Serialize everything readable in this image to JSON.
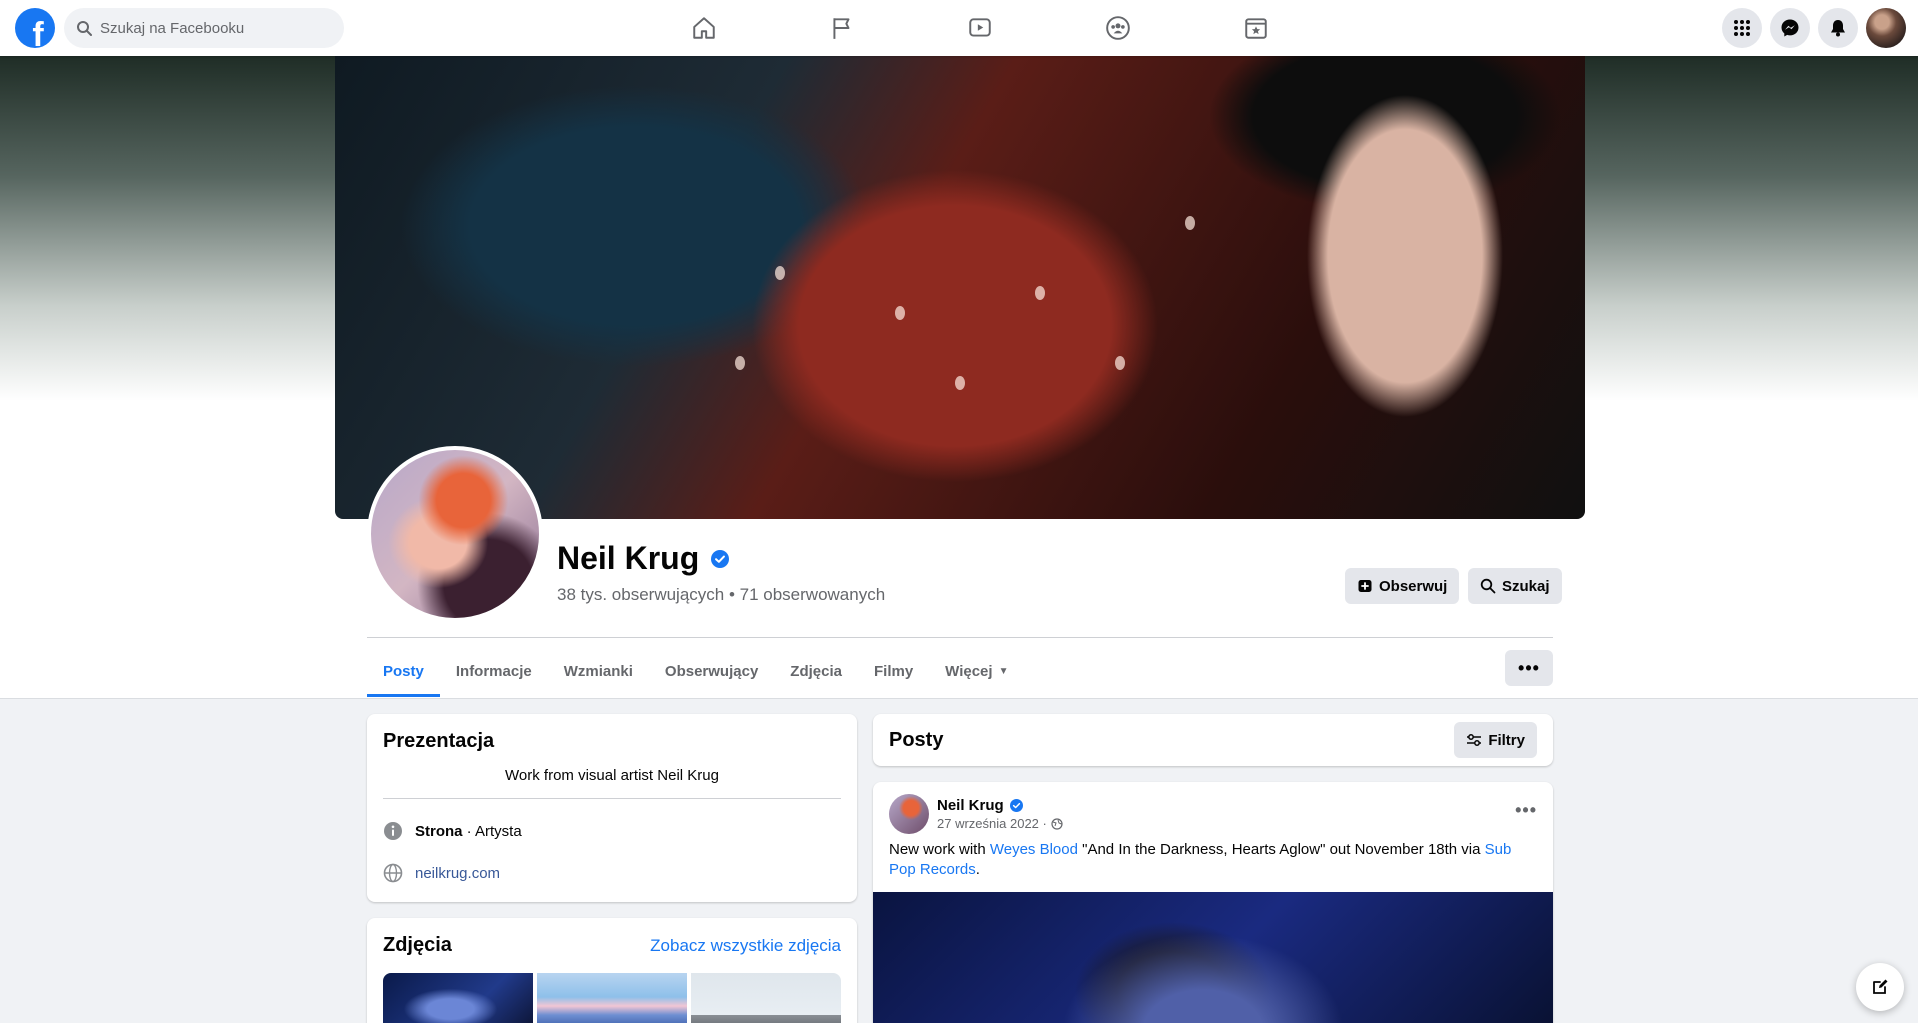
{
  "topbar": {
    "logo_letter": "f",
    "search_placeholder": "Szukaj na Facebooku",
    "nav_icons": [
      "home-icon",
      "flag-icon",
      "watch-icon",
      "groups-icon",
      "gaming-icon"
    ],
    "right_icons": [
      "menu-grid-icon",
      "messenger-icon",
      "bell-icon",
      "account-avatar"
    ]
  },
  "profile": {
    "name": "Neil Krug",
    "stats": "38 tys. obserwujących • 71 obserwowanych",
    "follow_label": "Obserwuj",
    "search_label": "Szukaj",
    "more_label": "•••"
  },
  "tabs": [
    {
      "label": "Posty",
      "active": true
    },
    {
      "label": "Informacje"
    },
    {
      "label": "Wzmianki"
    },
    {
      "label": "Obserwujący"
    },
    {
      "label": "Zdjęcia"
    },
    {
      "label": "Filmy"
    },
    {
      "label": "Więcej"
    }
  ],
  "intro": {
    "title": "Prezentacja",
    "bio": "Work from visual artist Neil Krug",
    "page_type_bold": "Strona",
    "page_type_rest": " · Artysta",
    "website": "neilkrug.com"
  },
  "photos": {
    "title": "Zdjęcia",
    "see_all": "Zobacz wszystkie zdjęcia"
  },
  "posts": {
    "title": "Posty",
    "filter_label": "Filtry"
  },
  "post": {
    "author": "Neil Krug",
    "date": "27 września 2022 ·",
    "dots": "•••",
    "text_1": "New work with ",
    "link_1": "Weyes Blood",
    "text_2": " \"And In the Darkness, Hearts Aglow\" out November 18th via ",
    "link_2": "Sub Pop Records",
    "text_3": "."
  },
  "colors": {
    "accent": "#1877f2",
    "secondary_text": "#65676b",
    "button_bg": "#e4e6eb",
    "page_bg": "#f0f2f5"
  }
}
